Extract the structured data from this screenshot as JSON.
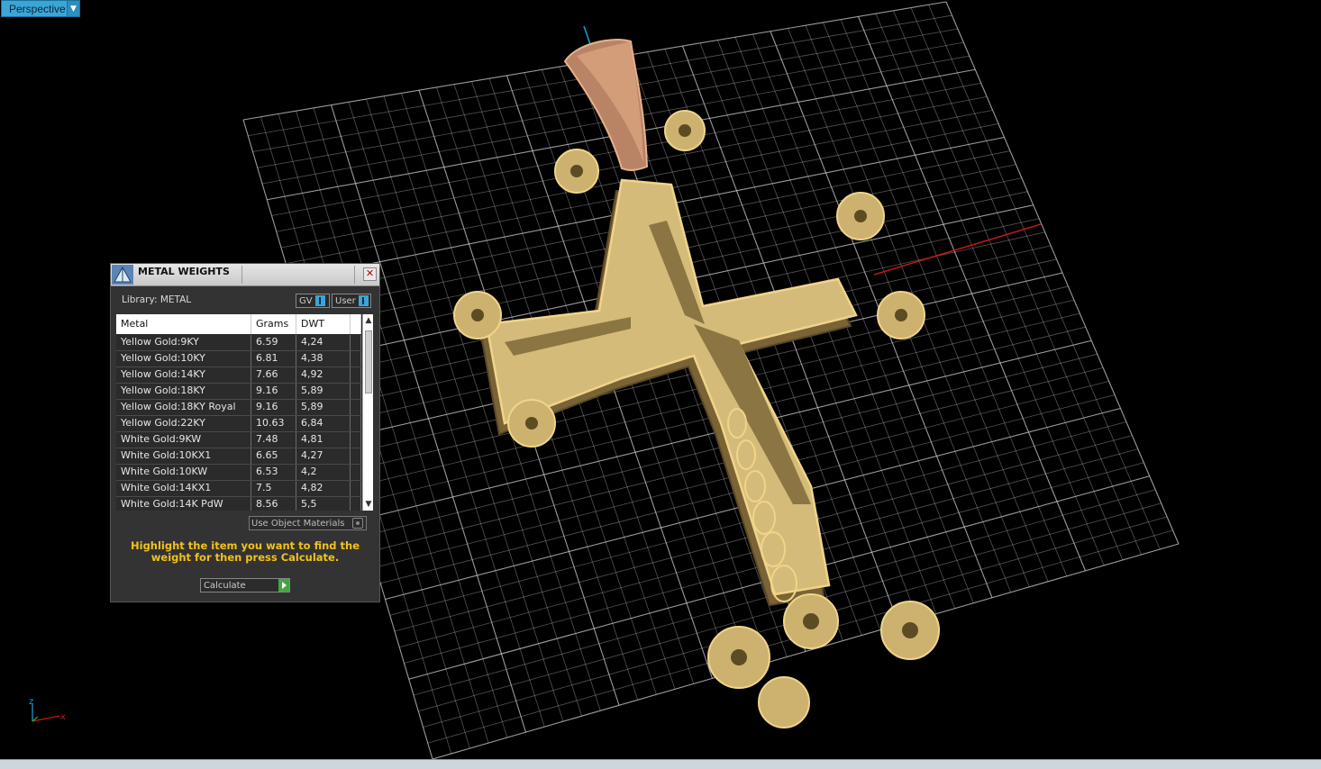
{
  "viewport": {
    "view_label": "Perspective"
  },
  "axis_gizmo": {
    "z_label": "z",
    "x_label": "x"
  },
  "panel": {
    "title": "METAL WEIGHTS",
    "library_label": "Library: METAL",
    "toggle_gv": "GV",
    "toggle_user": "User",
    "columns": [
      "Metal",
      "Grams",
      "DWT"
    ],
    "rows": [
      [
        "Yellow Gold:9KY",
        "6.59",
        "4,24"
      ],
      [
        "Yellow Gold:10KY",
        "6.81",
        "4,38"
      ],
      [
        "Yellow Gold:14KY",
        "7.66",
        "4,92"
      ],
      [
        "Yellow Gold:18KY",
        "9.16",
        "5,89"
      ],
      [
        "Yellow Gold:18KY Royal",
        "9.16",
        "5,89"
      ],
      [
        "Yellow Gold:22KY",
        "10.63",
        "6,84"
      ],
      [
        "White Gold:9KW",
        "7.48",
        "4,81"
      ],
      [
        "White Gold:10KX1",
        "6.65",
        "4,27"
      ],
      [
        "White Gold:10KW",
        "6.53",
        "4,2"
      ],
      [
        "White Gold:14KX1",
        "7.5",
        "4,82"
      ],
      [
        "White Gold:14K PdW",
        "8.56",
        "5,5"
      ]
    ],
    "use_object_materials": "Use Object Materials",
    "hint": "Highlight the item you want to find the weight for then press Calculate.",
    "calculate": "Calculate"
  },
  "colors": {
    "accent": "#3aa6d8",
    "hint_text": "#f2c21a",
    "gold_top": "#e7cf8e",
    "gold_side": "#8e7641",
    "bail": "#c99472",
    "grid": "#cfcfcf"
  }
}
